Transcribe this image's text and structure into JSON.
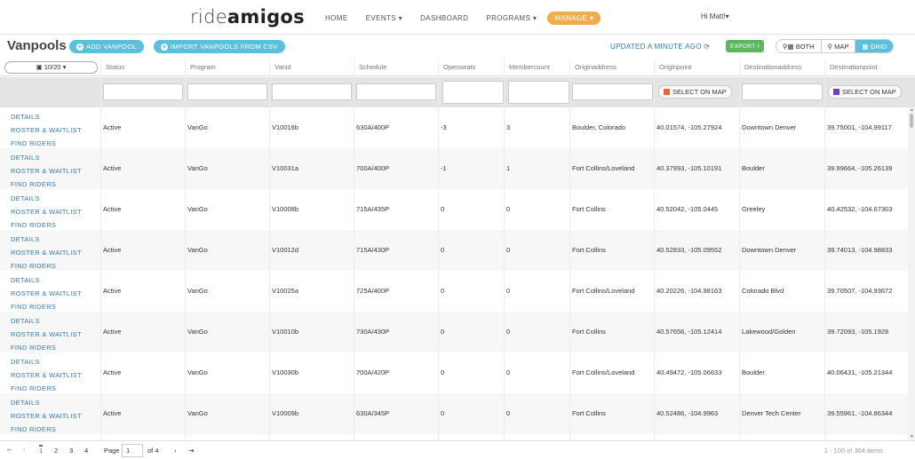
{
  "brand": {
    "logo_light": "ride",
    "logo_bold": "amigos"
  },
  "nav": {
    "home": "HOME",
    "events": "EVENTS",
    "dashboard": "DASHBOARD",
    "programs": "PROGRAMS",
    "manage": "MANAGE",
    "user": "Hi Matt!"
  },
  "toolbar": {
    "title": "Vanpools",
    "add_label": "ADD VANPOOL",
    "import_label": "IMPORT VANPOOLS FROM CSV",
    "updated": "UPDATED A MINUTE AGO",
    "export": "EXPORT",
    "view_both": "BOTH",
    "view_map": "MAP",
    "view_grid": "GRID"
  },
  "grid": {
    "page_size": "10/20",
    "columns": [
      "Status",
      "Program",
      "Vanid",
      "Schedule",
      "Openseats",
      "Membercount",
      "Originaddress",
      "Originpoint",
      "Destinationaddress",
      "Destinationpoint"
    ],
    "select_on_map": "SELECT ON MAP",
    "actions": [
      "DETAILS",
      "ROSTER & WAITLIST",
      "FIND RIDERS"
    ],
    "rows": [
      {
        "status": "Active",
        "program": "VanGo",
        "vanid": "V10016b",
        "schedule": "630A/400P",
        "openseats": "-3",
        "membercount": "3",
        "origin": "Boulder, Colorado",
        "originpoint": "40.01574, -105.27924",
        "dest": "Downtown Denver",
        "destpoint": "39.75001, -104.99117"
      },
      {
        "status": "Active",
        "program": "VanGo",
        "vanid": "V10031a",
        "schedule": "700A/400P",
        "openseats": "-1",
        "membercount": "1",
        "origin": "Fort Collins/Loveland",
        "originpoint": "40.37993, -105.10191",
        "dest": "Boulder",
        "destpoint": "39.99664, -105.26139"
      },
      {
        "status": "Active",
        "program": "VanGo",
        "vanid": "V10008b",
        "schedule": "715A/435P",
        "openseats": "0",
        "membercount": "0",
        "origin": "Fort Collins",
        "originpoint": "40.52042, -105.0445",
        "dest": "Greeley",
        "destpoint": "40.42532, -104.67303"
      },
      {
        "status": "Active",
        "program": "VanGo",
        "vanid": "V10012d",
        "schedule": "715A/430P",
        "openseats": "0",
        "membercount": "0",
        "origin": "Fort Collins",
        "originpoint": "40.52833, -105.09552",
        "dest": "Downtown Denver",
        "destpoint": "39.74013, -104.98833"
      },
      {
        "status": "Active",
        "program": "VanGo",
        "vanid": "V10025a",
        "schedule": "725A/400P",
        "openseats": "0",
        "membercount": "0",
        "origin": "Fort Collins/Loveland",
        "originpoint": "40.20226, -104.98163",
        "dest": "Colorado Blvd",
        "destpoint": "39.70507, -104.93672"
      },
      {
        "status": "Active",
        "program": "VanGo",
        "vanid": "V10010b",
        "schedule": "730A/430P",
        "openseats": "0",
        "membercount": "0",
        "origin": "Fort Collins",
        "originpoint": "40.57656, -105.12414",
        "dest": "Lakewood/Golden",
        "destpoint": "39.72093, -105.1928"
      },
      {
        "status": "Active",
        "program": "VanGo",
        "vanid": "V10030b",
        "schedule": "700A/420P",
        "openseats": "0",
        "membercount": "0",
        "origin": "Fort Collins/Loveland",
        "originpoint": "40.49472, -105.06633",
        "dest": "Boulder",
        "destpoint": "40.06431, -105.21344"
      },
      {
        "status": "Active",
        "program": "VanGo",
        "vanid": "V10009b",
        "schedule": "630A/345P",
        "openseats": "0",
        "membercount": "0",
        "origin": "Fort Collins",
        "originpoint": "40.52486, -104.9963",
        "dest": "Denver Tech Center",
        "destpoint": "39.55961, -104.86344"
      }
    ]
  },
  "pager": {
    "pages": [
      "1",
      "2",
      "3",
      "4"
    ],
    "page_label": "Page",
    "page_value": "1",
    "of_label": "of 4",
    "items": "1 - 100 of 304 items"
  },
  "colors": {
    "accent": "#5bc0de",
    "manage": "#f0ad4e",
    "export": "#5cb85c",
    "link": "#337ab7",
    "origin_marker": "#f26522",
    "dest_marker": "#6f42c1"
  }
}
